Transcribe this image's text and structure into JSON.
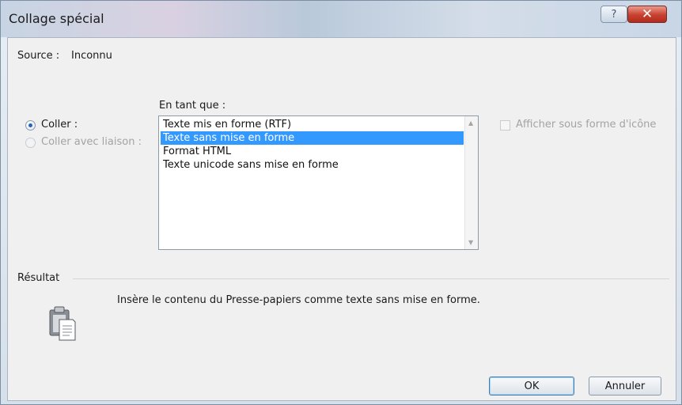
{
  "window": {
    "title": "Collage spécial"
  },
  "source": {
    "label": "Source :",
    "value": "Inconnu"
  },
  "format_label": "En tant que :",
  "options": [
    {
      "label": "Coller :",
      "checked": true,
      "enabled": true
    },
    {
      "label": "Coller avec liaison :",
      "checked": false,
      "enabled": false
    }
  ],
  "list": {
    "items": [
      "Texte mis en forme (RTF)",
      "Texte sans mise en forme",
      "Format HTML",
      "Texte unicode sans mise en forme"
    ],
    "selected_index": 1
  },
  "icon_checkbox": {
    "label": "Afficher sous forme d'icône",
    "checked": false,
    "enabled": false
  },
  "result": {
    "heading": "Résultat",
    "description": "Insère le contenu du Presse-papiers comme texte sans mise en forme.",
    "icon": "clipboard-icon"
  },
  "buttons": {
    "ok": "OK",
    "cancel": "Annuler"
  },
  "icons": {
    "help": "?",
    "close": "✕"
  },
  "colors": {
    "selection": "#3399ff",
    "close_button": "#c8402f"
  }
}
